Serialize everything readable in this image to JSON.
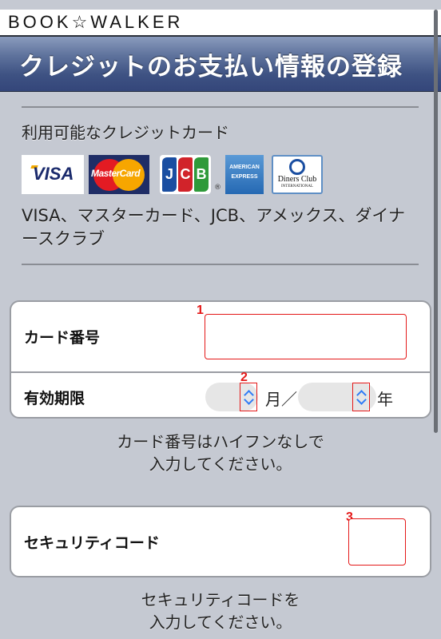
{
  "brand": {
    "logo_text": "BOOK☆WALKER"
  },
  "header": {
    "title": "クレジットのお支払い情報の登録"
  },
  "available_cards": {
    "label": "利用可能なクレジットカード",
    "logos": [
      {
        "name": "visa",
        "text": "VISA"
      },
      {
        "name": "mastercard",
        "text": "MasterCard"
      },
      {
        "name": "jcb",
        "letters": [
          "J",
          "C",
          "B"
        ]
      },
      {
        "name": "american-express",
        "line1": "AMERICAN",
        "line2": "EXPRESS"
      },
      {
        "name": "diners-club",
        "line1": "Diners Club",
        "line2": "INTERNATIONAL"
      }
    ],
    "registered_mark": "®",
    "description": "VISA、マスターカード、JCB、アメックス、ダイナースクラブ"
  },
  "card_form": {
    "card_number": {
      "label": "カード番号",
      "value": "",
      "annotation": "1"
    },
    "expiry": {
      "label": "有効期限",
      "month_value": "",
      "month_unit": "月／",
      "year_value": "",
      "year_unit": "年",
      "annotation": "2"
    },
    "hint": [
      "カード番号はハイフンなしで",
      "入力してください。"
    ]
  },
  "security_form": {
    "security_code": {
      "label": "セキュリティコード",
      "value": "",
      "annotation": "3"
    },
    "hint": [
      "セキュリティコードを",
      "入力してください。"
    ]
  },
  "colors": {
    "background": "#c5c9d2",
    "title_bar": "#3e5283",
    "annotation_red": "#e41919",
    "select_chevron": "#2f7cf6"
  }
}
